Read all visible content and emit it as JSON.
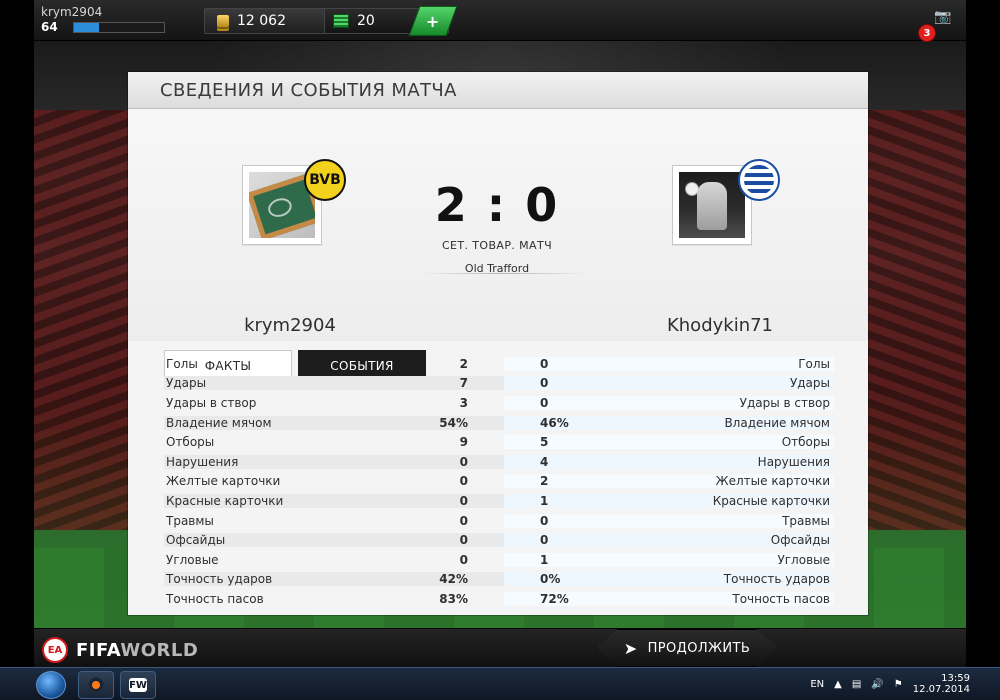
{
  "top_bar": {
    "username": "krym2904",
    "level": "64",
    "xp_progress": 0.28,
    "coins": "12 062",
    "points": "20",
    "add_label": "+",
    "notifications_count": "3"
  },
  "panel": {
    "title": "СВЕДЕНИЯ И СОБЫТИЯ МАТЧА",
    "home": {
      "name": "krym2904",
      "badge_text": "BVB"
    },
    "away": {
      "name": "Khodykin71"
    },
    "score": "2 : 0",
    "match_type": "СЕТ. ТОВАР. МАТЧ",
    "stadium": "Old Trafford",
    "tabs": {
      "facts": "ФАКТЫ",
      "events": "СОБЫТИЯ"
    },
    "stats": [
      {
        "label": "Голы",
        "home": "2",
        "away": "0"
      },
      {
        "label": "Удары",
        "home": "7",
        "away": "0"
      },
      {
        "label": "Удары в створ",
        "home": "3",
        "away": "0"
      },
      {
        "label": "Владение мячом",
        "home": "54%",
        "away": "46%"
      },
      {
        "label": "Отборы",
        "home": "9",
        "away": "5"
      },
      {
        "label": "Нарушения",
        "home": "0",
        "away": "4"
      },
      {
        "label": "Желтые карточки",
        "home": "0",
        "away": "2"
      },
      {
        "label": "Красные карточки",
        "home": "0",
        "away": "1"
      },
      {
        "label": "Травмы",
        "home": "0",
        "away": "0"
      },
      {
        "label": "Офсайды",
        "home": "0",
        "away": "0"
      },
      {
        "label": "Угловые",
        "home": "0",
        "away": "1"
      },
      {
        "label": "Точность ударов",
        "home": "42%",
        "away": "0%"
      },
      {
        "label": "Точность пасов",
        "home": "83%",
        "away": "72%"
      }
    ]
  },
  "bottom_bar": {
    "brand_ea": "EA",
    "brand_fifa": "FIFA",
    "brand_world": "WORLD",
    "continue_label": "ПРОДОЛЖИТЬ"
  },
  "taskbar": {
    "language": "EN",
    "time": "13:59",
    "date": "12.07.2014",
    "fw_label": "FW"
  },
  "colors": {
    "accent_green": "#168a2b",
    "xp_blue": "#2b8ddb",
    "notif_red": "#e01f1f"
  }
}
